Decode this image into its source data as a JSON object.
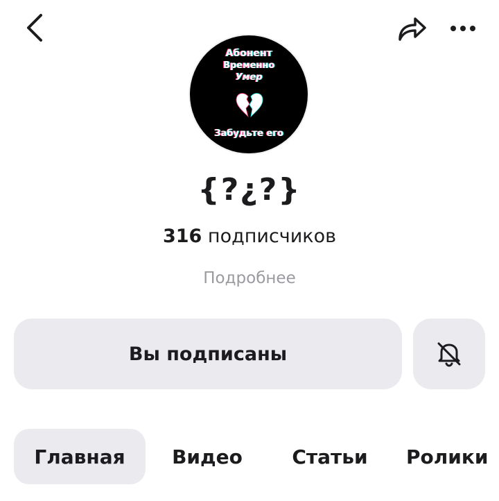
{
  "header": {
    "back_icon": "chevron-left-icon",
    "share_icon": "share-arrow-icon",
    "more_icon": "more-horizontal-icon"
  },
  "avatar": {
    "line1": "Абонент",
    "line2": "Временно",
    "line3": "Умер",
    "line4": "Забудьте его",
    "icon": "broken-heart-icon"
  },
  "channel": {
    "name": "{?¿?}",
    "subscribers_count": "316",
    "subscribers_label": "подписчиков",
    "details_link": "Подробнее"
  },
  "actions": {
    "subscribed_label": "Вы подписаны",
    "bell_icon": "bell-off-icon"
  },
  "tabs": [
    {
      "label": "Главная",
      "selected": true
    },
    {
      "label": "Видео",
      "selected": false
    },
    {
      "label": "Статьи",
      "selected": false
    },
    {
      "label": "Ролики",
      "selected": false
    }
  ],
  "colors": {
    "text": "#1c1c1e",
    "muted": "#9a9aa0",
    "button_bg": "#ebebef",
    "avatar_bg": "#000000"
  }
}
